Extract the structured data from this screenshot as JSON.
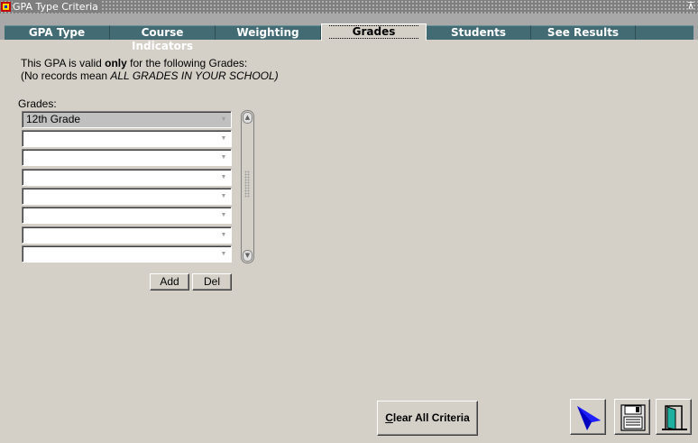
{
  "window": {
    "title": "GPA Type Criteria",
    "max_glyph": "⊼"
  },
  "tabs": [
    {
      "label": "GPA Type"
    },
    {
      "label": "Course Indicators"
    },
    {
      "label": "Weighting"
    },
    {
      "label": "Grades",
      "active": true
    },
    {
      "label": "Students"
    },
    {
      "label": "See Results"
    }
  ],
  "info": {
    "line1_pre": "This GPA is valid ",
    "line1_bold": "only",
    "line1_post": " for the following Grades:",
    "line2_pre": "(No records mean ",
    "line2_italic": "ALL GRADES IN YOUR SCHOOL)"
  },
  "grades": {
    "label": "Grades:",
    "rows": [
      "12th Grade",
      "",
      "",
      "",
      "",
      "",
      "",
      ""
    ],
    "add_label": "Add",
    "del_label": "Del"
  },
  "footer": {
    "clear_first": "C",
    "clear_rest": "lear All Criteria"
  },
  "icons": {
    "toolbar": [
      "cursor-arrow-icon",
      "save-disk-icon",
      "exit-door-icon"
    ]
  },
  "colors": {
    "background": "#d4d0c8",
    "tab": "#426b73",
    "tabbar": "#a8a8a8",
    "titlebar": "#7f7f7f",
    "arrow_icon": "#0000c0"
  }
}
